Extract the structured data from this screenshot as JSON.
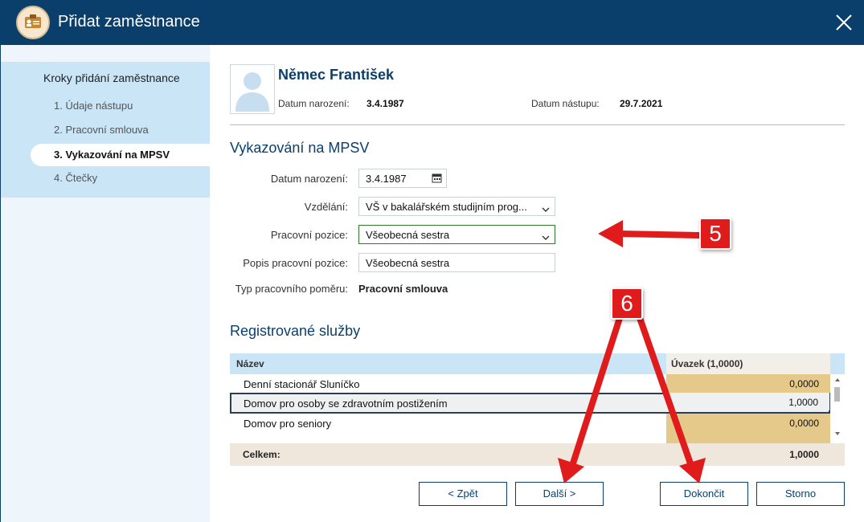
{
  "window": {
    "title": "Přidat zaměstnance",
    "accent": "#0b3f6b"
  },
  "sidebar": {
    "heading": "Kroky přidání zaměstnance",
    "steps": [
      {
        "label": "1. Údaje nástupu"
      },
      {
        "label": "2. Pracovní smlouva"
      },
      {
        "label": "3. Vykazování na MPSV",
        "active": true
      },
      {
        "label": "4. Čtečky"
      }
    ]
  },
  "employee": {
    "name": "Němec František",
    "birth_label": "Datum narození:",
    "birth_value": "3.4.1987",
    "start_label": "Datum nástupu:",
    "start_value": "29.7.2021"
  },
  "mpsv": {
    "title": "Vykazování na MPSV",
    "birth_label": "Datum narození:",
    "birth_value": "3.4.1987",
    "education_label": "Vzdělání:",
    "education_value": "VŠ v bakalářském studijním prog...",
    "position_label": "Pracovní pozice:",
    "position_value": "Všeobecná sestra",
    "position_desc_label": "Popis pracovní pozice:",
    "position_desc_value": "Všeobecná sestra",
    "employment_type_label": "Typ pracovního poměru:",
    "employment_type_value": "Pracovní smlouva"
  },
  "services": {
    "title": "Registrované služby",
    "col_name": "Název",
    "col_uvazek": "Úvazek (1,0000)",
    "rows": [
      {
        "name": "Denní stacionář Sluníčko",
        "value": "0,0000"
      },
      {
        "name": "Domov pro osoby se zdravotním postižením",
        "value": "1,0000",
        "selected": true
      },
      {
        "name": "Domov pro seniory",
        "value": "0,0000"
      }
    ],
    "total_label": "Celkem:",
    "total_value": "1,0000"
  },
  "buttons": {
    "back": "< Zpět",
    "next": "Další >",
    "finish": "Dokončit",
    "cancel": "Storno"
  },
  "annotations": {
    "badge5": "5",
    "badge6": "6",
    "color": "#e01b1b"
  }
}
